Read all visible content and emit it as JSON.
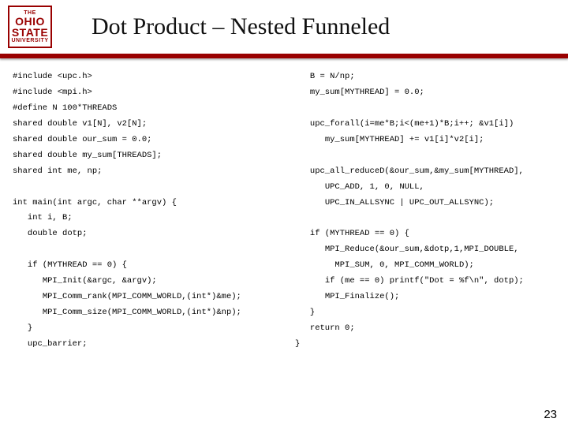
{
  "logo": {
    "line1": "THE",
    "line2": "OHIO",
    "line3": "STATE",
    "line4": "UNIVERSITY"
  },
  "title": "Dot Product – Nested Funneled",
  "code_left": "#include <upc.h>\n#include <mpi.h>\n#define N 100*THREADS\nshared double v1[N], v2[N];\nshared double our_sum = 0.0;\nshared double my_sum[THREADS];\nshared int me, np;\n\nint main(int argc, char **argv) {\n   int i, B;\n   double dotp;\n\n   if (MYTHREAD == 0) {\n      MPI_Init(&argc, &argv);\n      MPI_Comm_rank(MPI_COMM_WORLD,(int*)&me);\n      MPI_Comm_size(MPI_COMM_WORLD,(int*)&np);\n   }\n   upc_barrier;",
  "code_right": "   B = N/np;\n   my_sum[MYTHREAD] = 0.0;\n\n   upc_forall(i=me*B;i<(me+1)*B;i++; &v1[i])\n      my_sum[MYTHREAD] += v1[i]*v2[i];\n\n   upc_all_reduceD(&our_sum,&my_sum[MYTHREAD],\n      UPC_ADD, 1, 0, NULL,\n      UPC_IN_ALLSYNC | UPC_OUT_ALLSYNC);\n\n   if (MYTHREAD == 0) {\n      MPI_Reduce(&our_sum,&dotp,1,MPI_DOUBLE,\n        MPI_SUM, 0, MPI_COMM_WORLD);\n      if (me == 0) printf(\"Dot = %f\\n\", dotp);\n      MPI_Finalize();\n   }\n   return 0;\n}",
  "page_number": "23"
}
